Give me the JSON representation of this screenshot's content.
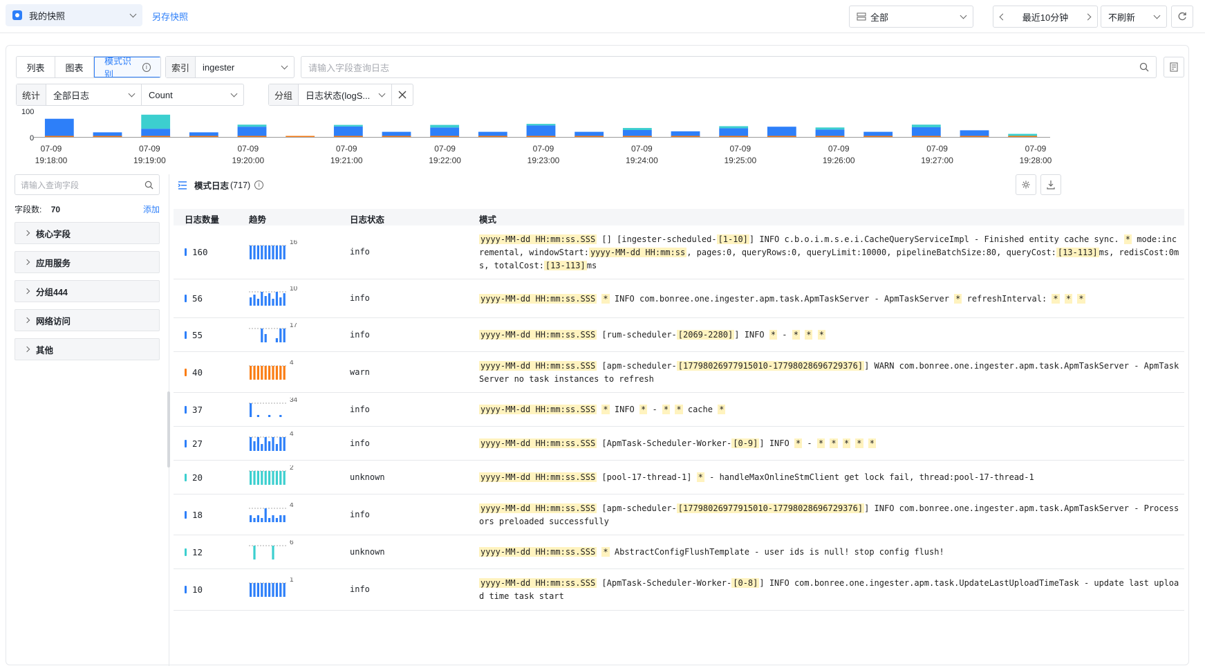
{
  "topbar": {
    "snapshot_label": "我的快照",
    "save_snapshot": "另存快照",
    "scope": "全部",
    "time_range": "最近10分钟",
    "refresh": "不刷新"
  },
  "tabs": [
    "列表",
    "图表",
    "模式识别"
  ],
  "index": {
    "label": "索引",
    "value": "ingester"
  },
  "search": {
    "placeholder": "请输入字段查询日志"
  },
  "stats": {
    "label": "统计",
    "scope": "全部日志",
    "metric": "Count"
  },
  "groupby": {
    "label": "分组",
    "value": "日志状态(logS..."
  },
  "colors": {
    "accent": "#2d7ff9",
    "info": "#2d7ff9",
    "warn": "#fa7d14",
    "unknown": "#3ccfcf"
  },
  "chart_data": {
    "type": "bar",
    "stacked": true,
    "ylim": [
      0,
      100
    ],
    "y_ticks": [
      "100",
      "0"
    ],
    "x_ticks": [
      [
        "07-09",
        "19:18:00"
      ],
      [
        "07-09",
        "19:19:00"
      ],
      [
        "07-09",
        "19:20:00"
      ],
      [
        "07-09",
        "19:21:00"
      ],
      [
        "07-09",
        "19:22:00"
      ],
      [
        "07-09",
        "19:23:00"
      ],
      [
        "07-09",
        "19:24:00"
      ],
      [
        "07-09",
        "19:25:00"
      ],
      [
        "07-09",
        "19:26:00"
      ],
      [
        "07-09",
        "19:27:00"
      ],
      [
        "07-09",
        "19:28:00"
      ]
    ],
    "series": [
      {
        "color": "#2d7ff9",
        "values": [
          71,
          18,
          32,
          18,
          40,
          0,
          41,
          20,
          37,
          20,
          45,
          20,
          27,
          22,
          34,
          40,
          29,
          20,
          38,
          26,
          0
        ]
      },
      {
        "color": "#3ccfcf",
        "values": [
          0,
          0,
          55,
          0,
          8,
          0,
          6,
          0,
          10,
          0,
          6,
          0,
          8,
          0,
          8,
          0,
          8,
          0,
          10,
          0,
          12
        ]
      },
      {
        "color": "#fa7d14",
        "values": [
          3,
          2,
          4,
          2,
          3,
          2,
          3,
          2,
          3,
          2,
          3,
          2,
          2,
          2,
          3,
          3,
          2,
          2,
          3,
          2,
          2
        ]
      }
    ]
  },
  "sidebar": {
    "search_placeholder": "请输入查询字段",
    "field_count_label": "字段数:",
    "field_count": "70",
    "add": "添加",
    "groups": [
      "核心字段",
      "应用服务",
      "分组444",
      "网络访问",
      "其他"
    ]
  },
  "patterns_header": {
    "title": "模式日志",
    "count": "(717)"
  },
  "columns": [
    "日志数量",
    "趋势",
    "日志状态",
    "模式"
  ],
  "rows": [
    {
      "count": "160",
      "status": "info",
      "max": "16",
      "trend": [
        1,
        1,
        1,
        1,
        1,
        1,
        1,
        1,
        1,
        1
      ],
      "segments": [
        [
          "yyyy-MM-dd HH:mm:ss.SSS",
          1
        ],
        [
          " [] [ingester-scheduled-",
          0
        ],
        [
          "[1-10]",
          1
        ],
        [
          "] INFO c.b.o.i.m.s.e.i.CacheQueryServiceImpl - Finished entity cache sync. ",
          0
        ],
        [
          "*",
          1
        ],
        [
          " mode:incremental, windowStart:",
          0
        ],
        [
          "yyyy-MM-dd HH:mm:ss",
          1
        ],
        [
          ", pages:0, queryRows:0, queryLimit:10000, pipelineBatchSize:80, queryCost:",
          0
        ],
        [
          "[13-113]",
          1
        ],
        [
          "ms, redisCost:0ms, totalCost:",
          0
        ],
        [
          "[13-113]",
          1
        ],
        [
          "ms",
          0
        ]
      ]
    },
    {
      "count": "56",
      "status": "info",
      "max": "10",
      "trend": [
        0.6,
        0.8,
        0.5,
        1,
        0.7,
        0.9,
        0.5,
        1,
        0.6,
        0.9
      ],
      "segments": [
        [
          "yyyy-MM-dd HH:mm:ss.SSS",
          1
        ],
        [
          " ",
          0
        ],
        [
          "*",
          1
        ],
        [
          " INFO com.bonree.one.ingester.apm.task.ApmTaskServer - ApmTaskServer ",
          0
        ],
        [
          "*",
          1
        ],
        [
          " refreshInterval: ",
          0
        ],
        [
          "*",
          1
        ],
        [
          " ",
          0
        ],
        [
          "*",
          1
        ],
        [
          " ",
          0
        ],
        [
          "*",
          1
        ]
      ]
    },
    {
      "count": "55",
      "status": "info",
      "max": "17",
      "trend": [
        0,
        0,
        0,
        1,
        0.6,
        0,
        0,
        0.3,
        1,
        1
      ],
      "segments": [
        [
          "yyyy-MM-dd HH:mm:ss.SSS",
          1
        ],
        [
          " [rum-scheduler-",
          0
        ],
        [
          "[2069-2280]",
          1
        ],
        [
          "] INFO ",
          0
        ],
        [
          "*",
          1
        ],
        [
          " - ",
          0
        ],
        [
          "*",
          1
        ],
        [
          " ",
          0
        ],
        [
          "*",
          1
        ],
        [
          " ",
          0
        ],
        [
          "*",
          1
        ]
      ]
    },
    {
      "count": "40",
      "status": "warn",
      "max": "4",
      "trend": [
        1,
        1,
        1,
        1,
        1,
        1,
        1,
        1,
        1,
        1
      ],
      "segments": [
        [
          "yyyy-MM-dd HH:mm:ss.SSS",
          1
        ],
        [
          " [apm-scheduler-",
          0
        ],
        [
          "[17798026977915010-17798028696729376]",
          1
        ],
        [
          "] WARN com.bonree.one.ingester.apm.task.ApmTaskServer - ApmTaskServer no task instances to refresh",
          0
        ]
      ]
    },
    {
      "count": "37",
      "status": "info",
      "max": "34",
      "trend": [
        1,
        0,
        0.15,
        0,
        0,
        0.15,
        0,
        0,
        0.15,
        0
      ],
      "segments": [
        [
          "yyyy-MM-dd HH:mm:ss.SSS",
          1
        ],
        [
          " ",
          0
        ],
        [
          "*",
          1
        ],
        [
          " INFO ",
          0
        ],
        [
          "*",
          1
        ],
        [
          " - ",
          0
        ],
        [
          "*",
          1
        ],
        [
          " ",
          0
        ],
        [
          "*",
          1
        ],
        [
          " cache ",
          0
        ],
        [
          "*",
          1
        ]
      ]
    },
    {
      "count": "27",
      "status": "info",
      "max": "4",
      "trend": [
        1,
        0.7,
        1,
        0.5,
        1,
        0.7,
        1,
        0.5,
        1,
        1
      ],
      "segments": [
        [
          "yyyy-MM-dd HH:mm:ss.SSS",
          1
        ],
        [
          " [ApmTask-Scheduler-Worker-",
          0
        ],
        [
          "[0-9]",
          1
        ],
        [
          "] INFO ",
          0
        ],
        [
          "*",
          1
        ],
        [
          " - ",
          0
        ],
        [
          "*",
          1
        ],
        [
          " ",
          0
        ],
        [
          "*",
          1
        ],
        [
          " ",
          0
        ],
        [
          "*",
          1
        ],
        [
          " ",
          0
        ],
        [
          "*",
          1
        ],
        [
          " ",
          0
        ],
        [
          "*",
          1
        ]
      ]
    },
    {
      "count": "20",
      "status": "unknown",
      "max": "2",
      "trend": [
        1,
        1,
        1,
        1,
        1,
        1,
        1,
        1,
        1,
        1
      ],
      "segments": [
        [
          "yyyy-MM-dd HH:mm:ss.SSS",
          1
        ],
        [
          " [pool-17-thread-1] ",
          0
        ],
        [
          "*",
          1
        ],
        [
          " - handleMaxOnlineStmClient get lock fail, thread:pool-17-thread-1",
          0
        ]
      ]
    },
    {
      "count": "18",
      "status": "info",
      "max": "4",
      "trend": [
        0.5,
        0.3,
        0.5,
        0.3,
        1,
        0.3,
        0.5,
        0.3,
        0.5,
        0.5
      ],
      "segments": [
        [
          "yyyy-MM-dd HH:mm:ss.SSS",
          1
        ],
        [
          " [apm-scheduler-",
          0
        ],
        [
          "[17798026977915010-17798028696729376]",
          1
        ],
        [
          "] INFO com.bonree.one.ingester.apm.task.ApmTaskServer - Processors preloaded successfully",
          0
        ]
      ]
    },
    {
      "count": "12",
      "status": "unknown",
      "max": "6",
      "trend": [
        0,
        1,
        0,
        0,
        0,
        0,
        1,
        0,
        0,
        0
      ],
      "segments": [
        [
          "yyyy-MM-dd HH:mm:ss.SSS",
          1
        ],
        [
          " ",
          0
        ],
        [
          "*",
          1
        ],
        [
          " AbstractConfigFlushTemplate - user ids is null! stop config flush!",
          0
        ]
      ]
    },
    {
      "count": "10",
      "status": "info",
      "max": "1",
      "trend": [
        1,
        1,
        1,
        1,
        1,
        1,
        1,
        1,
        1,
        1
      ],
      "segments": [
        [
          "yyyy-MM-dd HH:mm:ss.SSS",
          1
        ],
        [
          " [ApmTask-Scheduler-Worker-",
          0
        ],
        [
          "[0-8]",
          1
        ],
        [
          "] INFO com.bonree.one.ingester.apm.task.UpdateLastUploadTimeTask - update last upload time task start",
          0
        ]
      ]
    }
  ]
}
